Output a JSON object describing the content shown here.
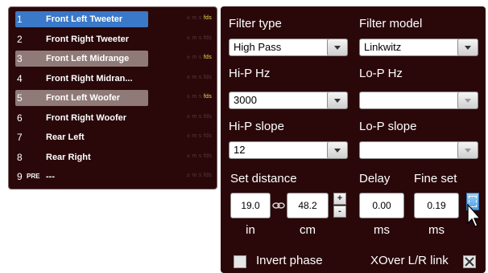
{
  "channels": [
    {
      "num": "1",
      "pre": "",
      "name": "Front Left Tweeter",
      "selected": "blue",
      "fds_on": true
    },
    {
      "num": "2",
      "pre": "",
      "name": "Front Right Tweeter",
      "selected": "",
      "fds_on": false
    },
    {
      "num": "3",
      "pre": "",
      "name": "Front Left Midrange",
      "selected": "gray",
      "fds_on": true
    },
    {
      "num": "4",
      "pre": "",
      "name": "Front Right Midran...",
      "selected": "",
      "fds_on": false
    },
    {
      "num": "5",
      "pre": "",
      "name": "Front Left Woofer",
      "selected": "gray",
      "fds_on": true
    },
    {
      "num": "6",
      "pre": "",
      "name": "Front Right Woofer",
      "selected": "",
      "fds_on": false
    },
    {
      "num": "7",
      "pre": "",
      "name": "Rear Left",
      "selected": "",
      "fds_on": false
    },
    {
      "num": "8",
      "pre": "",
      "name": "Rear Right",
      "selected": "",
      "fds_on": false
    },
    {
      "num": "9",
      "pre": "PRE",
      "name": "---",
      "selected": "",
      "fds_on": false
    }
  ],
  "channel_units": "± m s",
  "channel_fds": "fds",
  "filter": {
    "type_label": "Filter type",
    "type_value": "High Pass",
    "model_label": "Filter model",
    "model_value": "Linkwitz",
    "hip_hz_label": "Hi-P Hz",
    "hip_hz_value": "3000",
    "lop_hz_label": "Lo-P Hz",
    "lop_hz_value": "",
    "hip_slope_label": "Hi-P slope",
    "hip_slope_value": "12",
    "lop_slope_label": "Lo-P slope",
    "lop_slope_value": ""
  },
  "distance": {
    "label": "Set distance",
    "inches": "19.0",
    "cm": "48.2",
    "unit_in": "in",
    "unit_cm": "cm",
    "plus": "+",
    "minus": "-"
  },
  "delay": {
    "label": "Delay",
    "value": "0.00",
    "unit": "ms",
    "fine_label": "Fine set",
    "fine_value": "0.19",
    "fine_unit": "ms"
  },
  "invert_phase_label": "Invert phase",
  "invert_phase_checked": false,
  "xover_label": "XOver L/R link",
  "xover_checked": true,
  "colors": {
    "panel": "#2a080a",
    "select_blue": "#3a78c8",
    "select_gray": "#8f7a77",
    "fds_on": "#f2e15a"
  }
}
